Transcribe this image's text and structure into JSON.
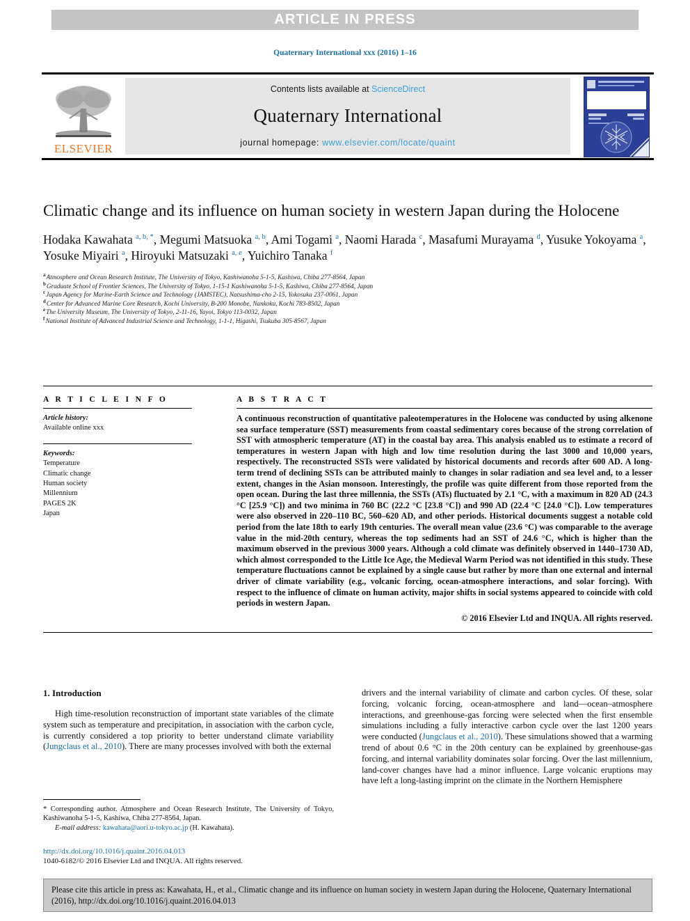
{
  "banner": {
    "text": "ARTICLE IN PRESS"
  },
  "running_head": {
    "text": "Quaternary International xxx (2016) 1–16",
    "color": "#1a6fa8"
  },
  "masthead": {
    "contents_prefix": "Contents lists available at ",
    "contents_link": "ScienceDirect",
    "journal_title": "Quaternary International",
    "homepage_prefix": "journal homepage: ",
    "homepage_url": "www.elsevier.com/locate/quaint",
    "publisher_logo_word": "ELSEVIER",
    "publisher_logo_color": "#e87722",
    "link_color": "#3f9fd4",
    "panel_bg": "#e6e6e6",
    "cover_bg": "#2b3f97"
  },
  "article": {
    "title": "Climatic change and its influence on human society in western Japan during the Holocene",
    "authors": [
      {
        "name": "Hodaka Kawahata",
        "marks": "a, b, *",
        "sep": ", "
      },
      {
        "name": "Megumi Matsuoka",
        "marks": "a, b",
        "sep": ", "
      },
      {
        "name": "Ami Togami",
        "marks": "a",
        "sep": ", "
      },
      {
        "name": "Naomi Harada",
        "marks": "c",
        "sep": ", "
      },
      {
        "name": "Masafumi Murayama",
        "marks": "d",
        "sep": ", "
      },
      {
        "name": "Yusuke Yokoyama",
        "marks": "a",
        "sep": ", "
      },
      {
        "name": "Yosuke Miyairi",
        "marks": "a",
        "sep": ", "
      },
      {
        "name": "Hiroyuki Matsuzaki",
        "marks": "a, e",
        "sep": ", "
      },
      {
        "name": "Yuichiro Tanaka",
        "marks": "f",
        "sep": ""
      }
    ],
    "affiliations": [
      {
        "mark": "a",
        "text": "Atmosphere and Ocean Research Institute, The University of Tokyo, Kashiwanoha 5-1-5, Kashiwa, Chiba 277-8564, Japan"
      },
      {
        "mark": "b",
        "text": "Graduate School of Frontier Sciences, The University of Tokyo, 1-15-1 Kashiwanoha 5-1-5, Kashiwa, Chiba 277-8564, Japan"
      },
      {
        "mark": "c",
        "text": "Japan Agency for Marine-Earth Science and Technology (JAMSTEC), Natsushima-cho 2-15, Yokosuka 237-0061, Japan"
      },
      {
        "mark": "d",
        "text": "Center for Advanced Marine Core Research, Kochi University, B-200 Monobe, Nankoku, Kochi 783-8502, Japan"
      },
      {
        "mark": "e",
        "text": "The University Museum, The University of Tokyo, 2-11-16, Yayoi, Tokyo 113-0032, Japan"
      },
      {
        "mark": "f",
        "text": "National Institute of Advanced Industrial Science and Technology, 1-1-1, Higashi, Tsukuba 305-8567, Japan"
      }
    ]
  },
  "article_info": {
    "heading": "A R T I C L E   I N F O",
    "history_label": "Article history:",
    "history_value": "Available online xxx",
    "keywords_label": "Keywords:",
    "keywords": [
      "Temperature",
      "Climatic change",
      "Human society",
      "Millennium",
      "PAGES 2K",
      "Japan"
    ]
  },
  "abstract": {
    "heading": "A B S T R A C T",
    "text": "A continuous reconstruction of quantitative paleotemperatures in the Holocene was conducted by using alkenone sea surface temperature (SST) measurements from coastal sedimentary cores because of the strong correlation of SST with atmospheric temperature (AT) in the coastal bay area. This analysis enabled us to estimate a record of temperatures in western Japan with high and low time resolution during the last 3000 and 10,000 years, respectively. The reconstructed SSTs were validated by historical documents and records after 600 AD. A long-term trend of declining SSTs can be attributed mainly to changes in solar radiation and sea level and, to a lesser extent, changes in the Asian monsoon. Interestingly, the profile was quite different from those reported from the open ocean. During the last three millennia, the SSTs (ATs) fluctuated by 2.1 °C, with a maximum in 820 AD (24.3 °C [25.9 °C]) and two minima in 760 BC (22.2 °C [23.8 °C]) and 990 AD (22.4 °C [24.0 °C]). Low temperatures were also observed in 220–110 BC, 560–620 AD, and other periods. Historical documents suggest a notable cold period from the late 18th to early 19th centuries. The overall mean value (23.6 °C) was comparable to the average value in the mid-20th century, whereas the top sediments had an SST of 24.6 °C, which is higher than the maximum observed in the previous 3000 years. Although a cold climate was definitely observed in 1440–1730 AD, which almost corresponded to the Little Ice Age, the Medieval Warm Period was not identified in this study. These temperature fluctuations cannot be explained by a single cause but rather by more than one external and internal driver of climate variability (e.g., volcanic forcing, ocean-atmosphere interactions, and solar forcing). With respect to the influence of climate on human activity, major shifts in social systems appeared to coincide with cold periods in western Japan.",
    "copyright": "© 2016 Elsevier Ltd and INQUA. All rights reserved."
  },
  "introduction": {
    "section_title": "1.  Introduction",
    "left_para_part1": "High time-resolution reconstruction of important state variables of the climate system such as temperature and precipitation, in association with the carbon cycle, is currently considered a top priority to better understand climate variability (",
    "left_citation": "Jungclaus et al., 2010",
    "left_para_part2": "). There are many processes involved with both the external",
    "right_para_part1": "drivers and the internal variability of climate and carbon cycles. Of these, solar forcing, volcanic forcing, ocean-atmosphere and land––ocean–atmosphere interactions, and greenhouse-gas forcing were selected when the first ensemble simulations including a fully interactive carbon cycle over the last 1200 years were conducted (",
    "right_citation": "Jungclaus et al., 2010",
    "right_para_part2": "). These simulations showed that a warming trend of about 0.6 °C in the 20th century can be explained by greenhouse-gas forcing, and internal variability dominates solar forcing. Over the last millennium, land-cover changes have had a minor influence. Large volcanic eruptions may have left a long-lasting imprint on the climate in the Northern Hemisphere"
  },
  "footnote": {
    "star": "*",
    "corresponding": " Corresponding author. Atmosphere and Ocean Research Institute, The University of Tokyo, Kashiwanoha 5-1-5, Kashiwa, Chiba 277-8564, Japan.",
    "email_label": "E-mail address:",
    "email": "kawahata@aori.u-tokyo.ac.jp",
    "email_owner": "(H. Kawahata)."
  },
  "doi_block": {
    "doi": "http://dx.doi.org/10.1016/j.quaint.2016.04.013",
    "issn": "1040-6182/© 2016 Elsevier Ltd and INQUA. All rights reserved."
  },
  "cite_box": {
    "text": "Please cite this article in press as: Kawahata, H., et al., Climatic change and its influence on human society in western Japan during the Holocene, Quaternary International (2016), http://dx.doi.org/10.1016/j.quaint.2016.04.013"
  }
}
